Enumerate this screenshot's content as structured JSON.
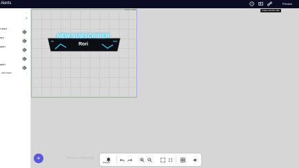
{
  "header": {
    "title": "Alerts",
    "preview_label": "Preview",
    "tooltip": "Image and file URL",
    "icons": [
      "help-icon",
      "screen-icon",
      "link-icon"
    ]
  },
  "sidebar": {
    "items": [
      {
        "label": "t alert"
      },
      {
        "label": "ept"
      },
      {
        "label": "alert"
      },
      {
        "label": ""
      },
      {
        "label": "alert"
      }
    ],
    "add_label": "add more"
  },
  "canvas": {
    "size_label": "1920 x 1080"
  },
  "alert": {
    "title": "NEW SUBSCRIBER",
    "name": "Rori"
  },
  "footer": {
    "move_hint": "Move a widget wit",
    "toolbar_label": "Widgets"
  },
  "colors": {
    "topbar": "#0b0b24",
    "accent": "#5a5ad8",
    "glow": "#2ad8ff"
  }
}
